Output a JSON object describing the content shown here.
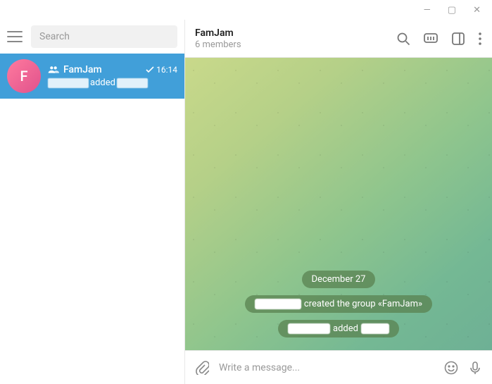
{
  "window": {
    "min": "—",
    "max": "▢",
    "close": "✕"
  },
  "sidebar": {
    "search_placeholder": "Search",
    "chat": {
      "avatar_letter": "F",
      "name": "FamJam",
      "time": "16:14",
      "preview_middle": "added"
    }
  },
  "header": {
    "title": "FamJam",
    "subtitle": "6 members"
  },
  "messages": {
    "date": "December 27",
    "created_text": "created the group «FamJam»",
    "added_text": " added "
  },
  "composer": {
    "placeholder": "Write a message..."
  }
}
